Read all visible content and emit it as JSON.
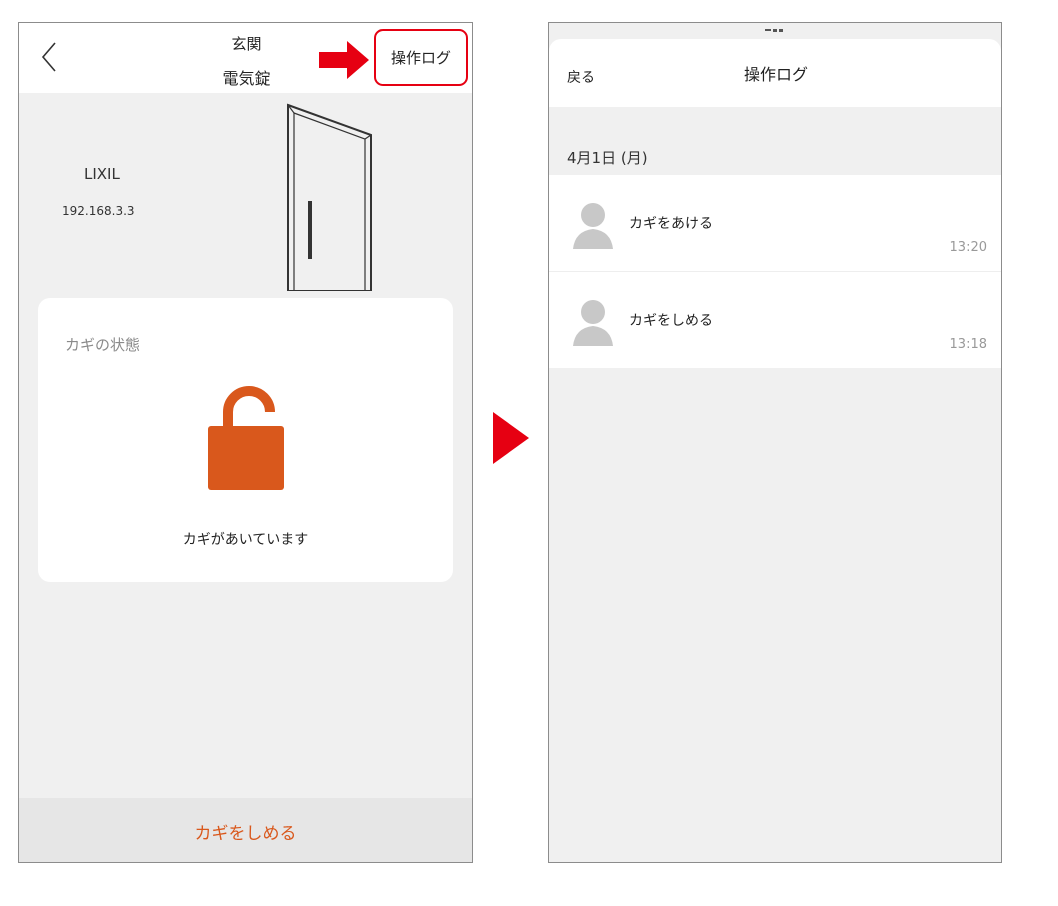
{
  "left_screen": {
    "header": {
      "location": "玄関",
      "device": "電気錠",
      "operation_log_button": "操作ログ"
    },
    "device_info": {
      "maker": "LIXIL",
      "ip_address": "192.168.3.3"
    },
    "status_card": {
      "title": "カギの状態",
      "status_text": "カギがあいています",
      "lock_state": "unlocked",
      "lock_color": "#d9581c"
    },
    "bottom_action": "カギをしめる"
  },
  "right_screen": {
    "header": {
      "back_label": "戻る",
      "title": "操作ログ"
    },
    "date": "4月1日 (月)",
    "log_entries": [
      {
        "icon": "user-avatar-icon",
        "action": "カギをあける",
        "time": "13:20"
      },
      {
        "icon": "user-avatar-icon",
        "action": "カギをしめる",
        "time": "13:18"
      }
    ]
  },
  "colors": {
    "accent": "#d9581c",
    "highlight": "#e60012",
    "background": "#f0f0f0"
  }
}
